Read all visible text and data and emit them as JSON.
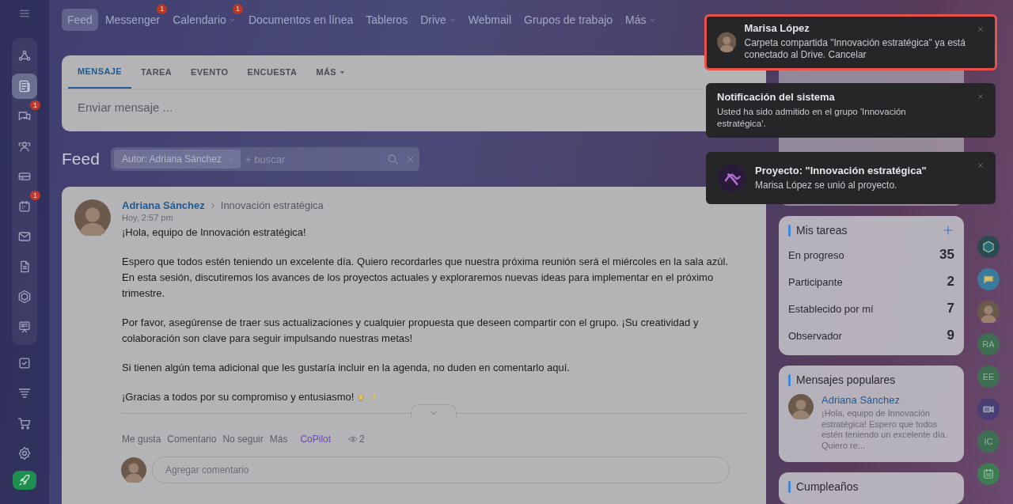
{
  "sidebar": {
    "items": [
      {
        "selected": false
      },
      {
        "selected": true
      },
      {
        "selected": false,
        "badge": "1"
      },
      {
        "selected": false
      },
      {
        "selected": false
      },
      {
        "selected": false,
        "badge": "1"
      },
      {
        "selected": false
      },
      {
        "selected": false
      },
      {
        "selected": false
      },
      {
        "selected": false
      },
      {
        "selected": false
      },
      {
        "selected": false
      },
      {
        "selected": false
      },
      {
        "selected": false
      },
      {
        "selected": false
      }
    ]
  },
  "nav": {
    "items": [
      {
        "label": "Feed",
        "selected": true,
        "dropdown": false
      },
      {
        "label": "Messenger",
        "selected": false,
        "dropdown": false,
        "badge": "1"
      },
      {
        "label": "Calendario",
        "selected": false,
        "dropdown": true,
        "badge": "1"
      },
      {
        "label": "Documentos en línea",
        "selected": false,
        "dropdown": false
      },
      {
        "label": "Tableros",
        "selected": false,
        "dropdown": false
      },
      {
        "label": "Drive",
        "selected": false,
        "dropdown": true
      },
      {
        "label": "Webmail",
        "selected": false,
        "dropdown": false
      },
      {
        "label": "Grupos de trabajo",
        "selected": false,
        "dropdown": false
      },
      {
        "label": "Más",
        "selected": false,
        "dropdown": true
      }
    ]
  },
  "composer": {
    "tabs": [
      {
        "label": "MENSAJE",
        "selected": true,
        "dropdown": false
      },
      {
        "label": "TAREA",
        "selected": false,
        "dropdown": false
      },
      {
        "label": "EVENTO",
        "selected": false,
        "dropdown": false
      },
      {
        "label": "ENCUESTA",
        "selected": false,
        "dropdown": false
      },
      {
        "label": "MÁS",
        "selected": false,
        "dropdown": true
      }
    ],
    "placeholder": "Enviar mensaje ..."
  },
  "feed": {
    "title": "Feed",
    "filter_tag": "Autor: Adriana Sánchez",
    "search_placeholder": "+ buscar"
  },
  "post": {
    "author": "Adriana Sánchez",
    "target": "Innovación estratégica",
    "time": "Hoy, 2:57 pm",
    "paragraphs": [
      "¡Hola, equipo de Innovación estratégica!",
      "Espero que todos estén teniendo un excelente día. Quiero recordarles que nuestra próxima reunión será el miércoles en la sala azúl. En esta sesión, discutiremos los avances de los proyectos actuales y exploraremos nuevas ideas para implementar en el próximo trimestre.",
      "Por favor, asegúrense de traer sus actualizaciones y cualquier propuesta que deseen compartir con el grupo. ¡Su creatividad y colaboración son clave para seguir impulsando nuestras metas!",
      "Si tienen algún tema adicional que les gustaría incluir en la agenda, no duden en comentarlo aquí.",
      "¡Gracias a todos por su compromiso y entusiasmo!"
    ],
    "actions": [
      "Me gusta",
      "Comentario",
      "No seguir",
      "Más"
    ],
    "copilot": "CoPilot",
    "views": "2",
    "comment_placeholder": "Agregar comentario"
  },
  "widgets": {
    "tasks": {
      "title": "Mis tareas",
      "rows": [
        {
          "label": "En progreso",
          "count": "35"
        },
        {
          "label": "Participante",
          "count": "2"
        },
        {
          "label": "Establecido por mí",
          "count": "7"
        },
        {
          "label": "Observador",
          "count": "9"
        }
      ]
    },
    "popular": {
      "title": "Mensajes populares",
      "author": "Adriana Sánchez",
      "excerpt": "¡Hola, equipo de Innovación estratégica! Espero que todos estén teniendo un excelente día. Quiero re..."
    },
    "birthdays": {
      "title": "Cumpleaños"
    }
  },
  "notifications": [
    {
      "title": "Marisa López",
      "text": "Carpeta compartida \"Innovación estratégica\" ya está conectado al Drive. Cancelar",
      "kind": "person",
      "highlighted": true
    },
    {
      "title": "Notificación del sistema",
      "text": "Usted ha sido admitido en el grupo 'Innovación estratégica'.",
      "kind": "system",
      "highlighted": false
    },
    {
      "title": "Proyecto: \"Innovación estratégica\"",
      "text": "Marisa López se unió al proyecto.",
      "kind": "project",
      "highlighted": false
    }
  ],
  "rail": {
    "items": [
      {
        "kind": "hexagon"
      },
      {
        "kind": "chat"
      },
      {
        "kind": "avatar"
      },
      {
        "kind": "initials",
        "label": "RA"
      },
      {
        "kind": "initials",
        "label": "EE"
      },
      {
        "kind": "video"
      },
      {
        "kind": "initials",
        "label": "IC"
      },
      {
        "kind": "calendar"
      }
    ]
  }
}
